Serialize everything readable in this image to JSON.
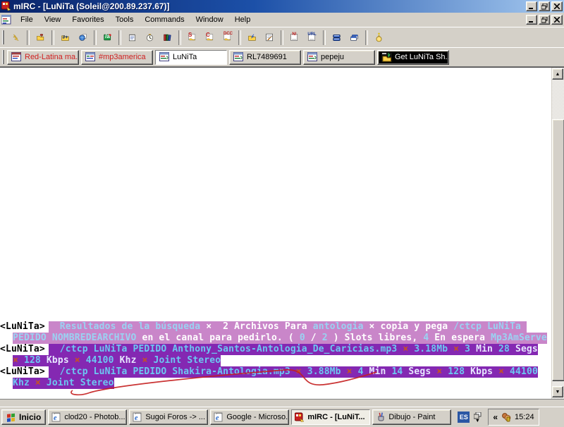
{
  "window": {
    "title": "mIRC - [LuNiTa (Soleil@200.89.237.67)]",
    "app_icon": "mirc-logo",
    "controls": [
      "minimize",
      "restore",
      "close"
    ]
  },
  "menu": {
    "items": [
      "File",
      "View",
      "Favorites",
      "Tools",
      "Commands",
      "Window",
      "Help"
    ]
  },
  "toolbar": {
    "icons": [
      {
        "name": "connect-icon",
        "kind": "lightning"
      },
      {
        "name": "separator",
        "kind": "sep"
      },
      {
        "name": "options-icon",
        "kind": "folder-tools"
      },
      {
        "name": "separator",
        "kind": "sep"
      },
      {
        "name": "channels-folder-icon",
        "kind": "folder-label",
        "label": "#+"
      },
      {
        "name": "channels-list-icon",
        "kind": "globe"
      },
      {
        "name": "separator",
        "kind": "sep"
      },
      {
        "name": "aliases-icon",
        "kind": "greenbox",
        "label": "/a"
      },
      {
        "name": "separator",
        "kind": "sep"
      },
      {
        "name": "notepad-icon",
        "kind": "notepad"
      },
      {
        "name": "timer-icon",
        "kind": "clock"
      },
      {
        "name": "address-book-icon",
        "kind": "books"
      },
      {
        "name": "separator",
        "kind": "sep"
      },
      {
        "name": "dcc-send-icon",
        "kind": "win-label",
        "label": "S"
      },
      {
        "name": "dcc-chat-icon",
        "kind": "win-label",
        "label": "C"
      },
      {
        "name": "dcc-options-icon",
        "kind": "win-label",
        "label": "DCC"
      },
      {
        "name": "separator",
        "kind": "sep"
      },
      {
        "name": "file-get-icon",
        "kind": "folder-arrow"
      },
      {
        "name": "script-editor-icon",
        "kind": "script"
      },
      {
        "name": "separator",
        "kind": "sep"
      },
      {
        "name": "notify-list-icon",
        "kind": "page-label",
        "label": "N!"
      },
      {
        "name": "url-list-icon",
        "kind": "page-label",
        "label": "URL"
      },
      {
        "name": "separator",
        "kind": "sep"
      },
      {
        "name": "tile-windows-icon",
        "kind": "tile"
      },
      {
        "name": "cascade-windows-icon",
        "kind": "cascade"
      },
      {
        "name": "separator",
        "kind": "sep"
      },
      {
        "name": "ontop-icon",
        "kind": "lamp"
      }
    ]
  },
  "switchbar": {
    "tabs": [
      {
        "label": "Red-Latina ma...",
        "text_color": "#d02020",
        "icon": "chat-window-icon",
        "state": "normal"
      },
      {
        "label": "#mp3america",
        "text_color": "#d02020",
        "icon": "channel-window-icon",
        "state": "normal"
      },
      {
        "label": "LuNiTa",
        "text_color": "#000000",
        "icon": "query-window-icon",
        "state": "active"
      },
      {
        "label": "RL7489691",
        "text_color": "#000000",
        "icon": "query-window-icon",
        "state": "normal"
      },
      {
        "label": "pepeju",
        "text_color": "#000000",
        "icon": "query-window-icon",
        "state": "normal"
      },
      {
        "label": "Get LuNiTa Sh...",
        "text_color": "#ffffff",
        "icon": "dcc-get-icon",
        "state": "flash"
      }
    ]
  },
  "chat": {
    "scroll_up_glyph": "▲",
    "scroll_down_glyph": "▼",
    "annotation_color": "#c41e1e",
    "messages": [
      {
        "nick": "<LuNiTa>",
        "bg": "#c986c9",
        "lines": [
          {
            "indent": false,
            "segments": [
              {
                "text": "  Resultados de la búsqueda ",
                "color": "#9ad2f2"
              },
              {
                "text": "×",
                "color": "#ffffff"
              },
              {
                "text": "  2 Archivos Para ",
                "color": "#ffffff"
              },
              {
                "text": "antologia",
                "color": "#9ad2f2"
              },
              {
                "text": " × ",
                "color": "#ffffff"
              },
              {
                "text": "copia y pega ",
                "color": "#ffffff"
              },
              {
                "text": "/ctcp LuNiTa ",
                "color": "#9ad2f2"
              }
            ]
          },
          {
            "indent": true,
            "segments": [
              {
                "text": "PEDIDO NOMBREDEARCHIVO",
                "color": "#9ad2f2"
              },
              {
                "text": " en el canal para pedirlo. ( ",
                "color": "#ffffff"
              },
              {
                "text": "0",
                "color": "#9ad2f2"
              },
              {
                "text": " / ",
                "color": "#ffffff"
              },
              {
                "text": "2",
                "color": "#9ad2f2"
              },
              {
                "text": " ) Slots libres, ",
                "color": "#ffffff"
              },
              {
                "text": "4",
                "color": "#9ad2f2"
              },
              {
                "text": " En espera ",
                "color": "#ffffff"
              },
              {
                "text": "Mp3AmServe",
                "color": "#9ad2f2"
              }
            ]
          }
        ]
      },
      {
        "nick": "<LuNiTa>",
        "bg": "#8428b2",
        "lines": [
          {
            "indent": false,
            "segments": [
              {
                "text": "  /ctcp LuNiTa PEDIDO Anthony_Santos-Antologia_De_Caricias.mp3",
                "color": "#6cc7f2"
              },
              {
                "text": " × ",
                "color": "#c8551e"
              },
              {
                "text": "3.18Mb",
                "color": "#6cc7f2"
              },
              {
                "text": " × ",
                "color": "#c8551e"
              },
              {
                "text": "3",
                "color": "#6cc7f2"
              },
              {
                "text": " Min ",
                "color": "#e6e6ff"
              },
              {
                "text": "28",
                "color": "#6cc7f2"
              },
              {
                "text": " Segs",
                "color": "#e6e6ff"
              }
            ]
          },
          {
            "indent": true,
            "segments": [
              {
                "text": "× ",
                "color": "#c8551e"
              },
              {
                "text": "128",
                "color": "#6cc7f2"
              },
              {
                "text": " Kbps ",
                "color": "#e6e6ff"
              },
              {
                "text": "× ",
                "color": "#c8551e"
              },
              {
                "text": "44100",
                "color": "#6cc7f2"
              },
              {
                "text": " Khz ",
                "color": "#e6e6ff"
              },
              {
                "text": "× ",
                "color": "#c8551e"
              },
              {
                "text": "Joint Stereo",
                "color": "#6cc7f2"
              }
            ]
          }
        ]
      },
      {
        "nick": "<LuNiTa>",
        "bg": "#8428b2",
        "lines": [
          {
            "indent": false,
            "segments": [
              {
                "text": "  /ctcp LuNiTa PEDIDO Shakira-Antologia.mp3",
                "color": "#6cc7f2"
              },
              {
                "text": " × ",
                "color": "#c8551e"
              },
              {
                "text": "3.88Mb",
                "color": "#6cc7f2"
              },
              {
                "text": " × ",
                "color": "#c8551e"
              },
              {
                "text": "4",
                "color": "#6cc7f2"
              },
              {
                "text": " Min ",
                "color": "#e6e6ff"
              },
              {
                "text": "14",
                "color": "#6cc7f2"
              },
              {
                "text": " Segs ",
                "color": "#e6e6ff"
              },
              {
                "text": "× ",
                "color": "#c8551e"
              },
              {
                "text": "128",
                "color": "#6cc7f2"
              },
              {
                "text": " Kbps ",
                "color": "#e6e6ff"
              },
              {
                "text": "× ",
                "color": "#c8551e"
              },
              {
                "text": "44100",
                "color": "#6cc7f2"
              }
            ]
          },
          {
            "indent": true,
            "segments": [
              {
                "text": "Khz ",
                "color": "#6cc7f2"
              },
              {
                "text": "× ",
                "color": "#c8551e"
              },
              {
                "text": "Joint Stereo",
                "color": "#6cc7f2"
              }
            ]
          }
        ]
      }
    ]
  },
  "taskbar": {
    "start_label": "Inicio",
    "tasks": [
      {
        "label": "clod20 - Photob...",
        "icon": "ie-icon",
        "active": false
      },
      {
        "label": "Sugoi Foros -> ...",
        "icon": "ie-icon",
        "active": false
      },
      {
        "label": "Google - Microso...",
        "icon": "ie-icon",
        "active": false
      },
      {
        "label": "mIRC - [LuNiT...",
        "icon": "mirc-icon",
        "active": true
      },
      {
        "label": "Dibujo - Paint",
        "icon": "paint-icon",
        "active": false
      }
    ],
    "language_badge": "ES",
    "tray_chevron": "«",
    "clock": "15:24"
  },
  "colors": {
    "titlebar_left": "#0a246a",
    "titlebar_right": "#a6caf0",
    "chrome": "#d4d0c8",
    "msg_pink_bg": "#c986c9",
    "msg_purple_bg": "#8428b2",
    "msg_cyan": "#6cc7f2",
    "msg_orange_x": "#c8551e",
    "tab_alert_red": "#d02020"
  }
}
